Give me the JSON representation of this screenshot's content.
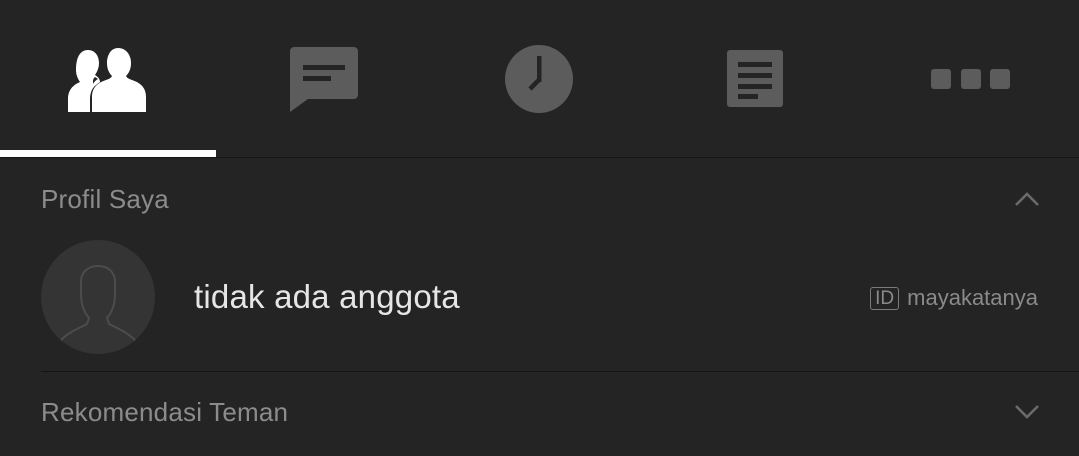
{
  "tabs": [
    {
      "icon": "friends-icon",
      "active": true
    },
    {
      "icon": "chat-icon",
      "active": false
    },
    {
      "icon": "clock-icon",
      "active": false
    },
    {
      "icon": "timeline-icon",
      "active": false
    },
    {
      "icon": "more-icon",
      "active": false
    }
  ],
  "colors": {
    "background": "#242424",
    "active_icon": "#ffffff",
    "inactive_icon": "#5c5c5c",
    "indicator": "#ffffff",
    "section_text": "#8c8c8c",
    "name_text": "#e6e6e6"
  },
  "profile_section": {
    "title": "Profil Saya",
    "expanded": true,
    "chevron_icon": "chevron-up-icon"
  },
  "profile": {
    "name": "tidak ada anggota",
    "id_badge": "ID",
    "id_value": "mayakatanya",
    "avatar_icon": "default-avatar-icon"
  },
  "recommend_section": {
    "title": "Rekomendasi Teman",
    "expanded": false,
    "chevron_icon": "chevron-down-icon"
  }
}
